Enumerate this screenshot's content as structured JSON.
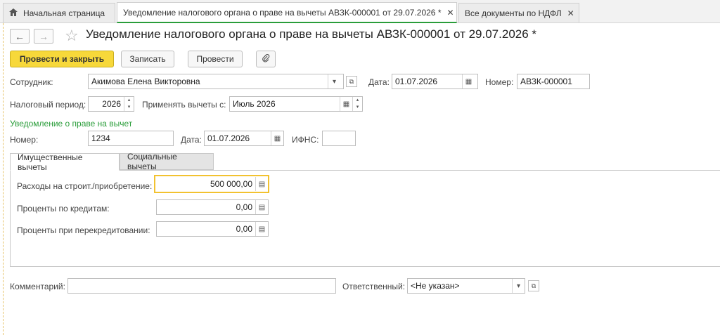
{
  "tabs": [
    {
      "label": "Начальная страница"
    },
    {
      "label": "Уведомление налогового органа о праве на вычеты АВЗК-000001 от 29.07.2026 *"
    },
    {
      "label": "Все документы по НДФЛ"
    }
  ],
  "nav": {
    "back": "←",
    "forward": "→",
    "star": "☆"
  },
  "document": {
    "title": "Уведомление налогового органа о праве на вычеты АВЗК-000001 от 29.07.2026 *"
  },
  "toolbar": {
    "post_close": "Провести и закрыть",
    "save": "Записать",
    "post": "Провести",
    "attach": "📎"
  },
  "header": {
    "employee_label": "Сотрудник:",
    "employee_value": "Акимова Елена Викторовна",
    "date_label": "Дата:",
    "date_value": "01.07.2026",
    "number_label": "Номер:",
    "number_value": "АВЗК-000001",
    "period_label": "Налоговый период:",
    "period_value": "2026",
    "apply_label": "Применять вычеты с:",
    "apply_value": "Июль 2026"
  },
  "notice": {
    "section_title": "Уведомление о праве на вычет",
    "number_label": "Номер:",
    "number_value": "1234",
    "date_label": "Дата:",
    "date_value": "01.07.2026",
    "ifns_label": "ИФНС:",
    "ifns_value": ""
  },
  "deduction_tabs": [
    {
      "label": "Имущественные вычеты"
    },
    {
      "label": "Социальные вычеты"
    }
  ],
  "property": {
    "rows": [
      {
        "label": "Расходы на строит./приобретение:",
        "value": "500 000,00"
      },
      {
        "label": "Проценты по кредитам:",
        "value": "0,00"
      },
      {
        "label": "Проценты при перекредитовании:",
        "value": "0,00"
      }
    ]
  },
  "footer": {
    "comment_label": "Комментарий:",
    "comment_value": "",
    "responsible_label": "Ответственный:",
    "responsible_value": "<Не указан>"
  },
  "colors": {
    "accent": "#f7d83a",
    "section": "#2a9d3a",
    "focus": "#f2c230"
  }
}
